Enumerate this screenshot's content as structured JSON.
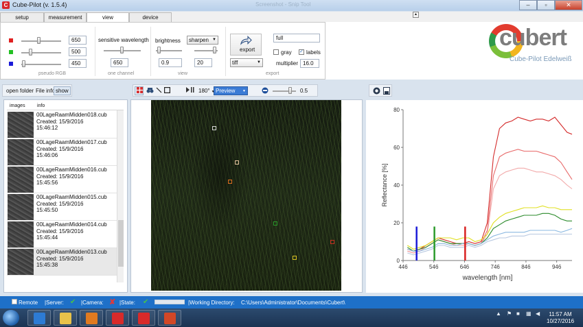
{
  "window": {
    "title": "Cube-Pilot (v. 1.5.4)",
    "ghost_title": "Screenshot - Snip Tool",
    "minimize": "–",
    "maximize": "▫",
    "close": "✕"
  },
  "tabs": [
    "setup",
    "measurement",
    "view",
    "device"
  ],
  "collapse": "▴",
  "pseudo_rgb": {
    "label": "pseudo RGB",
    "channels": [
      {
        "color": "#e02020",
        "value": "650",
        "level": 0.45
      },
      {
        "color": "#22c022",
        "value": "500",
        "level": 0.2
      },
      {
        "color": "#1a1ad8",
        "value": "450",
        "level": 0.05
      }
    ]
  },
  "one_channel": {
    "label": "one channel",
    "title": "sensitive wavelength",
    "value": "650",
    "level": 0.45
  },
  "view_group": {
    "label": "view",
    "brightness_label": "brightness",
    "brightness_value": "0.9",
    "sharpen_option": "sharpen",
    "sharpen_value": "20"
  },
  "export_group": {
    "label": "export",
    "export_label": "export",
    "format": "tiff",
    "name_value": "full",
    "gray_label": "gray",
    "labels_label": "labels",
    "multiplier_label": "multiplier",
    "multiplier_value": "16.0"
  },
  "logo": {
    "text": "cubert",
    "subtitle": "Cube-Pilot Edelweiß"
  },
  "left_toolbar": {
    "open_folder": "open folder",
    "file_info": "File info",
    "show": "show"
  },
  "mid_toolbar": {
    "rotation": "180°",
    "mode": "Preview"
  },
  "right_toolbar": {
    "opacity_value": "0.5"
  },
  "files_header": {
    "images": "images",
    "info": "info"
  },
  "files": [
    {
      "name": "00LageRaamMidden018.cub",
      "created": "Created: 15/9/2016",
      "time": "15:46:12"
    },
    {
      "name": "00LageRaamMidden017.cub",
      "created": "Created: 15/9/2016",
      "time": "15:46:06"
    },
    {
      "name": "00LageRaamMidden016.cub",
      "created": "Created: 15/9/2016",
      "time": "15:45:56"
    },
    {
      "name": "00LageRaamMidden015.cub",
      "created": "Created: 15/9/2016",
      "time": "15:45:50"
    },
    {
      "name": "00LageRaamMidden014.cub",
      "created": "Created: 15/9/2016",
      "time": "15:45:44"
    },
    {
      "name": "00LageRaamMidden013.cub",
      "created": "Created: 15/9/2016",
      "time": "15:45:38"
    }
  ],
  "roi_colors": [
    "#d8d8d8",
    "#e8c8a0",
    "#e07020",
    "#2a9a2a",
    "#d8c020",
    "#c83020"
  ],
  "chart_data": {
    "type": "line",
    "xlabel": "wavelength [nm]",
    "ylabel": "Reflectance [%]",
    "xlim": [
      446,
      996
    ],
    "ylim": [
      0,
      80
    ],
    "xticks": [
      446,
      546,
      646,
      746,
      846,
      946
    ],
    "yticks": [
      0,
      20,
      40,
      60,
      80
    ],
    "markers": [
      {
        "x": 490,
        "color": "#1a1ad8"
      },
      {
        "x": 548,
        "color": "#2a9a2a"
      },
      {
        "x": 648,
        "color": "#d82020"
      }
    ],
    "x": [
      460,
      480,
      500,
      520,
      540,
      560,
      580,
      600,
      620,
      640,
      660,
      680,
      700,
      720,
      740,
      760,
      780,
      800,
      820,
      840,
      860,
      880,
      900,
      920,
      940,
      960,
      980,
      996
    ],
    "series": [
      {
        "color": "#d42a2a",
        "values": [
          6,
          5,
          6,
          8,
          10,
          12,
          11,
          10,
          9,
          9,
          10,
          9,
          10,
          20,
          55,
          70,
          73,
          74,
          76,
          75,
          74,
          75,
          75,
          74,
          76,
          72,
          68,
          67
        ]
      },
      {
        "color": "#e86a6a",
        "values": [
          5,
          4,
          5,
          7,
          9,
          11,
          10,
          9,
          8,
          8,
          9,
          8,
          9,
          16,
          45,
          55,
          57,
          58,
          59,
          58,
          58,
          58,
          57,
          56,
          55,
          52,
          47,
          43
        ]
      },
      {
        "color": "#f2a9a9",
        "values": [
          5,
          4,
          5,
          7,
          9,
          11,
          10,
          9,
          8,
          8,
          9,
          8,
          9,
          14,
          38,
          45,
          47,
          48,
          49,
          49,
          48,
          47,
          47,
          46,
          45,
          43,
          40,
          38
        ]
      },
      {
        "color": "#e0e020",
        "values": [
          8,
          6,
          7,
          8,
          10,
          12,
          12,
          12,
          11,
          12,
          12,
          10,
          11,
          14,
          20,
          23,
          25,
          26,
          27,
          28,
          28,
          28,
          29,
          28,
          28,
          27,
          27,
          27
        ]
      },
      {
        "color": "#2a8a2a",
        "values": [
          7,
          5,
          6,
          7,
          9,
          11,
          10,
          9,
          9,
          9,
          9,
          8,
          9,
          12,
          17,
          19,
          21,
          22,
          23,
          24,
          24,
          24,
          25,
          25,
          24,
          22,
          21,
          21
        ]
      },
      {
        "color": "#8ab8e0",
        "values": [
          6,
          5,
          5,
          6,
          7,
          9,
          9,
          8,
          8,
          9,
          9,
          8,
          9,
          11,
          13,
          14,
          15,
          15,
          15,
          15,
          16,
          16,
          16,
          16,
          16,
          15,
          16,
          17
        ]
      },
      {
        "color": "#b8c8e0",
        "values": [
          4,
          3,
          4,
          5,
          6,
          8,
          8,
          7,
          7,
          7,
          8,
          7,
          8,
          10,
          11,
          12,
          12,
          13,
          13,
          13,
          14,
          14,
          14,
          14,
          14,
          14,
          14,
          14
        ]
      }
    ]
  },
  "status": {
    "remote": "Remote",
    "server": "|Server:",
    "camera": "|Camera:",
    "state": "|State:",
    "working_dir_label": "|Working Directory:",
    "working_dir_value": "C:\\Users\\Administrator\\Documents\\Cubert\\"
  },
  "taskbar": {
    "time": "11:57 AM",
    "date": "10/27/2016",
    "apps": [
      {
        "name": "ie",
        "color": "#2d7bd4"
      },
      {
        "name": "explorer",
        "color": "#e8c24a"
      },
      {
        "name": "media",
        "color": "#e07a20"
      },
      {
        "name": "cube-pilot-1",
        "color": "#d82a2a"
      },
      {
        "name": "cube-pilot-2",
        "color": "#d82a2a"
      },
      {
        "name": "powerpoint",
        "color": "#d24726"
      }
    ]
  }
}
